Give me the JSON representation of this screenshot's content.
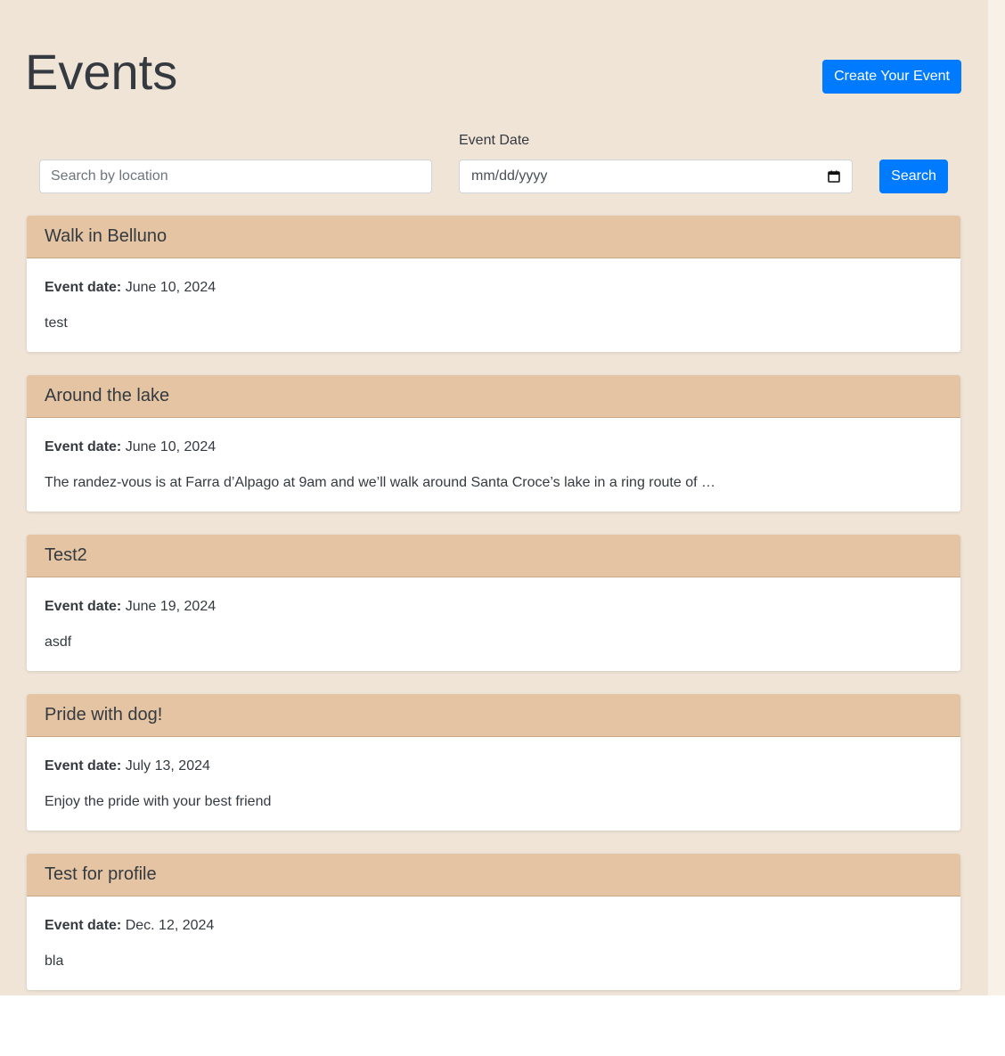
{
  "header": {
    "title": "Events",
    "create_button": "Create Your Event"
  },
  "search": {
    "location_placeholder": "Search by location",
    "date_label": "Event Date",
    "date_placeholder": "mm/dd/yyyy",
    "search_button": "Search"
  },
  "event_date_label": "Event date:",
  "events": [
    {
      "title": "Walk in Belluno",
      "date": "June 10, 2024",
      "description": "test"
    },
    {
      "title": "Around the lake",
      "date": "June 10, 2024",
      "description": "The randez-vous is at Farra d’Alpago at 9am and we’ll walk around Santa Croce’s lake in a ring route of …"
    },
    {
      "title": "Test2",
      "date": "June 19, 2024",
      "description": "asdf"
    },
    {
      "title": "Pride with dog!",
      "date": "July 13, 2024",
      "description": "Enjoy the pride with your best friend"
    },
    {
      "title": "Test for profile",
      "date": "Dec. 12, 2024",
      "description": "bla"
    }
  ],
  "colors": {
    "page_background": "#f0e4d7",
    "card_header": "#e4c4a2",
    "primary": "#007bff"
  },
  "icons": {
    "date_picker": "calendar-icon"
  }
}
